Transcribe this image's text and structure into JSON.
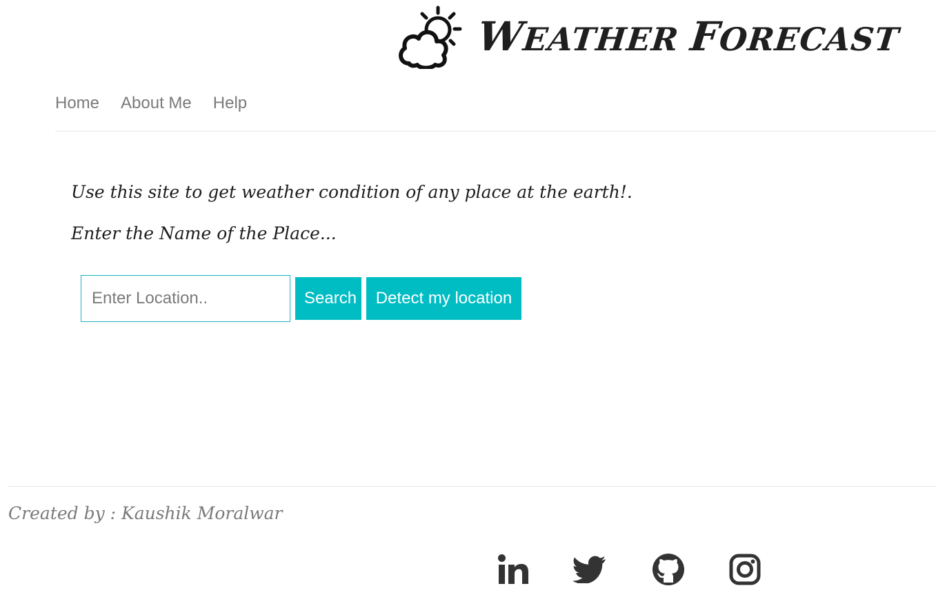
{
  "header": {
    "logo_icon": "weather-sun-cloud-icon",
    "title_parts": [
      {
        "text": "W",
        "size": "big"
      },
      {
        "text": "EATHER ",
        "size": "small"
      },
      {
        "text": "F",
        "size": "big"
      },
      {
        "text": "ORECAST",
        "size": "small"
      }
    ]
  },
  "nav": {
    "items": [
      {
        "label": "Home"
      },
      {
        "label": "About Me"
      },
      {
        "label": "Help"
      }
    ]
  },
  "main": {
    "intro": "Use this site to get weather condition of any place at the earth!.",
    "prompt": "Enter the Name of the Place...",
    "search": {
      "placeholder": "Enter Location..",
      "value": "",
      "search_label": "Search",
      "detect_label": "Detect my location"
    }
  },
  "footer": {
    "credit": "Created by : Kaushik Moralwar",
    "social": [
      {
        "icon": "linkedin-icon"
      },
      {
        "icon": "twitter-icon"
      },
      {
        "icon": "github-icon"
      },
      {
        "icon": "instagram-icon"
      }
    ]
  },
  "colors": {
    "accent": "#00bdc4",
    "nav_text": "#7a7a7a",
    "icon": "#333333"
  }
}
